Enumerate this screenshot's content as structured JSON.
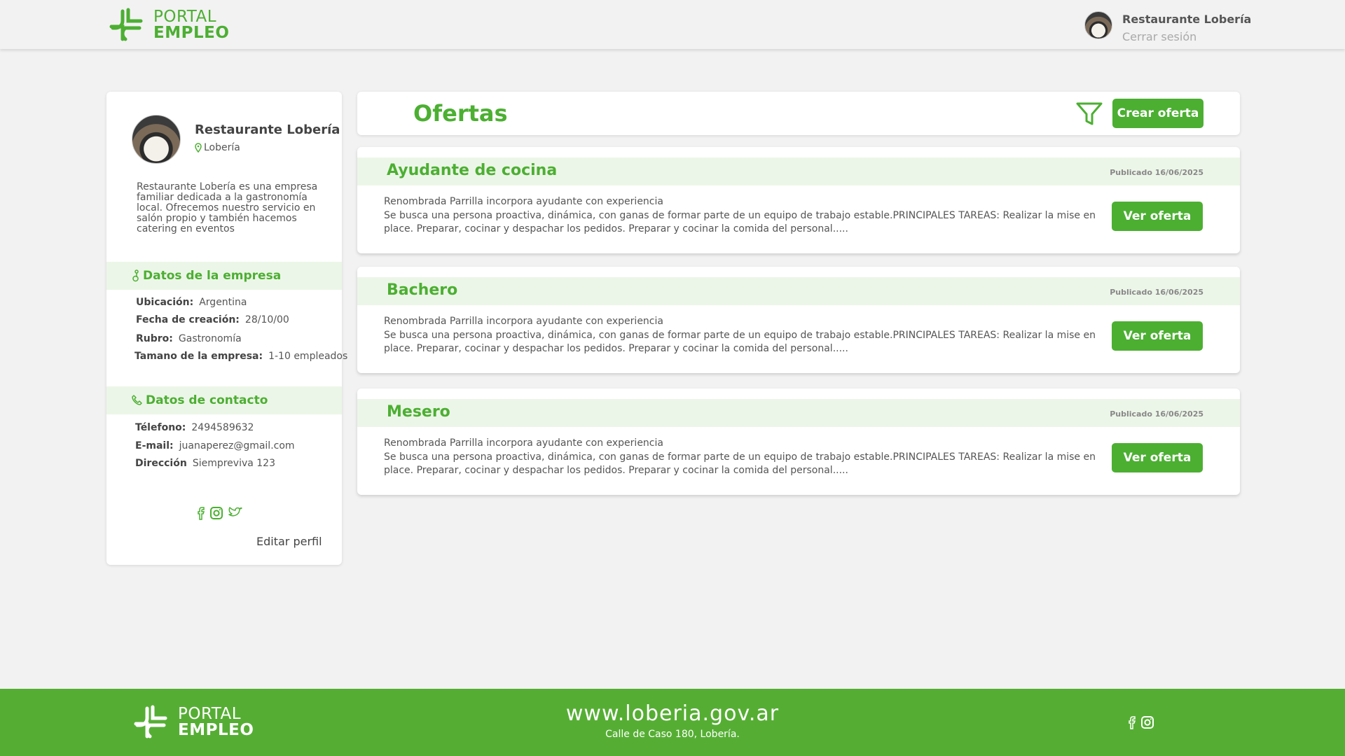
{
  "brand": {
    "line1": "PORTAL",
    "line2": "EMPLEO"
  },
  "header": {
    "user_name": "Restaurante Lobería",
    "logout_label": "Cerrar sesión"
  },
  "profile": {
    "name": "Restaurante Lobería",
    "location": "Lobería",
    "description": "Restaurante Lobería es una empresa familiar dedicada a la gastronomía local. Ofrecemos nuestro servicio en salón propio  y también hacemos catering en eventos",
    "company_section_title": "Datos de la empresa",
    "company_fields": [
      {
        "label": "Ubicación:",
        "value": "Argentina"
      },
      {
        "label": "Fecha de creación:",
        "value": "28/10/00"
      },
      {
        "label": "Rubro:",
        "value": "Gastronomía"
      },
      {
        "label": "Tamano de la empresa:",
        "value": "1-10 empleados"
      }
    ],
    "contact_section_title": "Datos de contacto",
    "contact_fields": [
      {
        "label": "Télefono:",
        "value": "2494589632"
      },
      {
        "label": "E-mail:",
        "value": "juanaperez@gmail.com"
      },
      {
        "label": "Dirección",
        "value": "Siempreviva 123"
      }
    ],
    "edit_label": "Editar perfil"
  },
  "offers": {
    "title": "Ofertas",
    "create_label": "Crear oferta",
    "view_label": "Ver oferta",
    "items": [
      {
        "title": "Ayudante de cocina",
        "date": "Publicado 16/06/2025",
        "subtitle": "Renombrada Parrilla incorpora ayudante con experiencia",
        "description": "Se busca una persona proactiva, dinámica, con ganas de formar parte de un equipo de trabajo estable.PRINCIPALES TAREAS: Realizar la mise en place. Preparar, cocinar y despachar los pedidos. Preparar y cocinar la comida del personal....."
      },
      {
        "title": "Bachero",
        "date": "Publicado 16/06/2025",
        "subtitle": "Renombrada Parrilla incorpora ayudante con experiencia",
        "description": "Se busca una persona proactiva, dinámica, con ganas de formar parte de un equipo de trabajo estable.PRINCIPALES TAREAS: Realizar la mise en place. Preparar, cocinar y despachar los pedidos. Preparar y cocinar la comida del personal....."
      },
      {
        "title": "Mesero",
        "date": "Publicado 16/06/2025",
        "subtitle": "Renombrada Parrilla incorpora ayudante con experiencia",
        "description": "Se busca una persona proactiva, dinámica, con ganas de formar parte de un equipo de trabajo estable.PRINCIPALES TAREAS: Realizar la mise en place. Preparar, cocinar y despachar los pedidos. Preparar y cocinar la comida del personal....."
      }
    ]
  },
  "footer": {
    "url": "www.loberia.gov.ar",
    "address": "Calle de Caso 180, Lobería."
  },
  "colors": {
    "brand_green": "#4caf32",
    "footer_green": "#55ae33",
    "band_green": "#ecf6e8"
  }
}
